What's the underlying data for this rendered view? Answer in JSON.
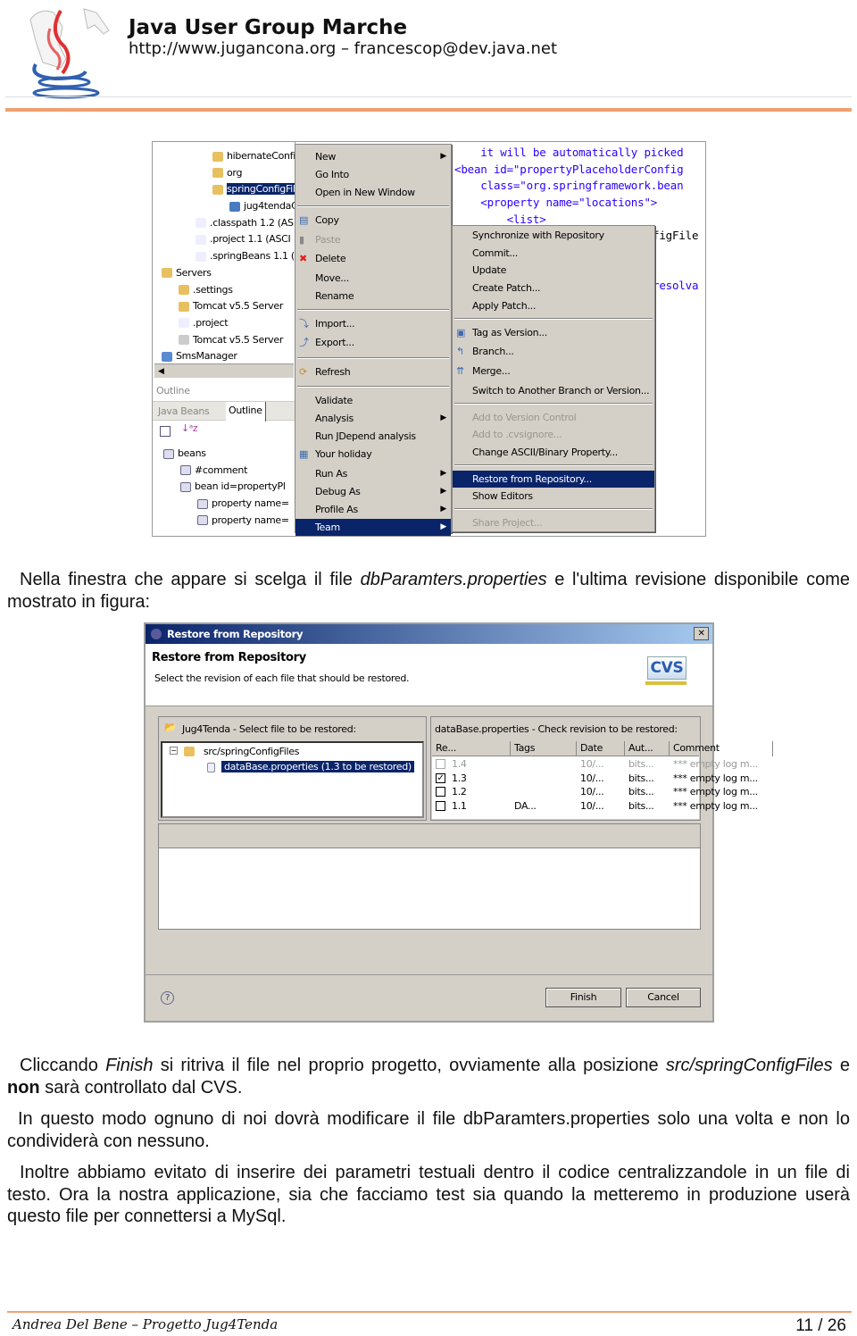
{
  "header": {
    "title": "Java User Group Marche",
    "subtitle": "http://www.jugancona.org – francescop@dev.java.net"
  },
  "screenshot1": {
    "tree": [
      {
        "label": "hibernateConfig",
        "level": 3,
        "icon": "folder"
      },
      {
        "label": "org",
        "level": 3,
        "icon": "folder"
      },
      {
        "label": "springConfigFile",
        "level": 3,
        "icon": "folder",
        "selected": true
      },
      {
        "label": "jug4tendaC",
        "level": 4,
        "icon": "spring-file"
      },
      {
        "label": ".classpath  1.2  (AS",
        "level": 2,
        "icon": "file"
      },
      {
        "label": ".project  1.1  (ASCI",
        "level": 2,
        "icon": "file"
      },
      {
        "label": ".springBeans  1.1  (",
        "level": 2,
        "icon": "file"
      },
      {
        "label": "Servers",
        "level": 0,
        "icon": "folder-open"
      },
      {
        "label": ".settings",
        "level": 1,
        "icon": "folder"
      },
      {
        "label": "Tomcat v5.5 Server",
        "level": 1,
        "icon": "folder"
      },
      {
        "label": ".project",
        "level": 1,
        "icon": "xml-file"
      },
      {
        "label": "Tomcat v5.5 Server",
        "level": 1,
        "icon": "server"
      },
      {
        "label": "SmsManager",
        "level": 0,
        "icon": "project"
      }
    ],
    "outline": {
      "title": "Outline",
      "tabs": [
        "Java Beans",
        "Outline"
      ],
      "items": [
        {
          "label": "beans",
          "level": 0
        },
        {
          "label": "#comment",
          "level": 1
        },
        {
          "label": "bean id=propertyPl",
          "level": 1
        },
        {
          "label": "property name=",
          "level": 2
        },
        {
          "label": "property name=",
          "level": 2
        }
      ]
    },
    "context_menu": [
      {
        "label": "New",
        "sub": true
      },
      {
        "label": "Go Into"
      },
      {
        "label": "Open in New Window"
      },
      {
        "sep": true
      },
      {
        "label": "Copy",
        "icon": "copy"
      },
      {
        "label": "Paste",
        "icon": "paste",
        "disabled": true
      },
      {
        "label": "Delete",
        "icon": "delete"
      },
      {
        "label": "Move..."
      },
      {
        "label": "Rename"
      },
      {
        "sep": true
      },
      {
        "label": "Import...",
        "icon": "import"
      },
      {
        "label": "Export...",
        "icon": "export"
      },
      {
        "sep": true
      },
      {
        "label": "Refresh",
        "icon": "refresh"
      },
      {
        "sep": true
      },
      {
        "label": "Validate"
      },
      {
        "label": "Analysis",
        "sub": true
      },
      {
        "label": "Run JDepend analysis"
      },
      {
        "label": "Your holiday",
        "icon": "calendar"
      },
      {
        "label": "Run As",
        "sub": true
      },
      {
        "label": "Debug As",
        "sub": true
      },
      {
        "label": "Profile As",
        "sub": true
      },
      {
        "label": "Team",
        "sub": true,
        "selected": true
      }
    ],
    "team_menu": [
      {
        "label": "Synchronize with Repository"
      },
      {
        "label": "Commit..."
      },
      {
        "label": "Update"
      },
      {
        "label": "Create Patch..."
      },
      {
        "label": "Apply Patch..."
      },
      {
        "sep": true
      },
      {
        "label": "Tag as Version...",
        "icon": "tag"
      },
      {
        "label": "Branch...",
        "icon": "branch"
      },
      {
        "label": "Merge...",
        "icon": "merge"
      },
      {
        "label": "Switch to Another Branch or Version..."
      },
      {
        "sep": true
      },
      {
        "label": "Add to Version Control",
        "disabled": true
      },
      {
        "label": "Add to .cvsignore...",
        "disabled": true
      },
      {
        "label": "Change ASCII/Binary Property..."
      },
      {
        "sep": true
      },
      {
        "label": "Restore from Repository...",
        "selected": true
      },
      {
        "label": "Show Editors"
      },
      {
        "sep": true
      },
      {
        "label": "Share Project...",
        "disabled": true
      }
    ],
    "code_lines": [
      "    it will be automatically picked",
      "<bean id=\"propertyPlaceholderConfig",
      "    class=\"org.springframework.bean",
      "    <property name=\"locations\">",
      "        <list>"
    ],
    "code_fragments": [
      "figFile",
      "resolva"
    ]
  },
  "paragraphs": {
    "p1": [
      "Nella finestra che appare si scelga il file ",
      "dbParamters.properties",
      " e l'ultima revisione disponibile come mostrato in figura:"
    ],
    "p2": [
      "Cliccando ",
      "Finish",
      " si ritriva il file nel proprio progetto, ovviamente alla posizione ",
      "src/springConfigFiles",
      " e ",
      "non",
      " sarà controllato dal CVS."
    ],
    "p3": "In questo modo ognuno di noi dovrà modificare il file dbParamters.properties solo una volta e non lo condividerà con nessuno.",
    "p4": "Inoltre abbiamo evitato di inserire dei parametri testuali dentro il codice centralizzandole in un file di testo. Ora la nostra applicazione, sia che facciamo test sia quando la metteremo in produzione userà questo file per connettersi a MySql."
  },
  "dialog": {
    "window_title": "Restore from Repository",
    "heading": "Restore from Repository",
    "description": "Select the revision of each file that should be restored.",
    "logo": "CVS",
    "left_panel_title": "Jug4Tenda - Select file to be restored:",
    "tree_folder": "src/springConfigFiles",
    "tree_file": "dataBase.properties (1.3 to be restored)",
    "right_panel_title": "dataBase.properties - Check revision to be restored:",
    "columns": [
      "Re...",
      "Tags",
      "Date",
      "Aut...",
      "Comment"
    ],
    "rows": [
      {
        "checked": false,
        "disabled": true,
        "rev": "1.4",
        "tags": "",
        "date": "10/...",
        "author": "bits...",
        "comment": "*** empty log m..."
      },
      {
        "checked": true,
        "rev": "1.3",
        "tags": "",
        "date": "10/...",
        "author": "bits...",
        "comment": "*** empty log m..."
      },
      {
        "checked": false,
        "rev": "1.2",
        "tags": "",
        "date": "10/...",
        "author": "bits...",
        "comment": "*** empty log m..."
      },
      {
        "checked": false,
        "rev": "1.1",
        "tags": "DA...",
        "date": "10/...",
        "author": "bits...",
        "comment": "*** empty log m..."
      }
    ],
    "finish": "Finish",
    "cancel": "Cancel",
    "help": "?",
    "close": "✕"
  },
  "footer": {
    "author": "Andrea Del Bene –  Progetto Jug4Tenda",
    "page": "11 / 26"
  },
  "colors": {
    "accent": "#f0a070",
    "selection": "#0a246a",
    "menu_bg": "#d4d0c8"
  }
}
